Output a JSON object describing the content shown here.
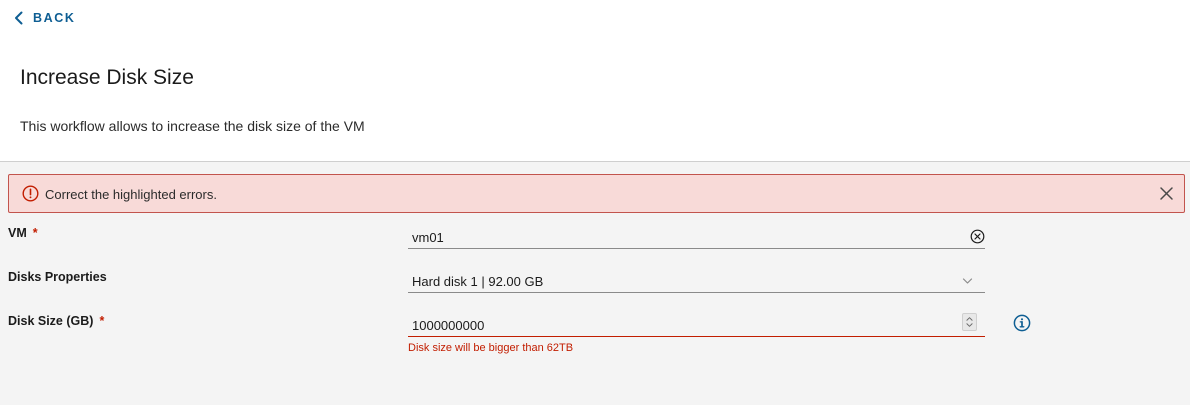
{
  "header": {
    "back_label": "BACK",
    "title": "Increase Disk Size",
    "description": "This workflow allows to increase the disk size of the VM"
  },
  "alert": {
    "message": "Correct the highlighted errors.",
    "icon": "error-icon",
    "close_icon": "close-icon"
  },
  "form": {
    "vm": {
      "label": "VM",
      "required_mark": "*",
      "value": "vm01"
    },
    "disks_properties": {
      "label": "Disks Properties",
      "value": "Hard disk 1 | 92.00 GB"
    },
    "disk_size": {
      "label": "Disk Size (GB)",
      "required_mark": "*",
      "value": "1000000000",
      "error": "Disk size will be bigger than 62TB"
    }
  },
  "colors": {
    "accent": "#0e5e93",
    "error": "#c21d00",
    "alert_background": "#f8dad8",
    "alert_border": "#c2544d",
    "content_background": "#f4f4f4"
  }
}
